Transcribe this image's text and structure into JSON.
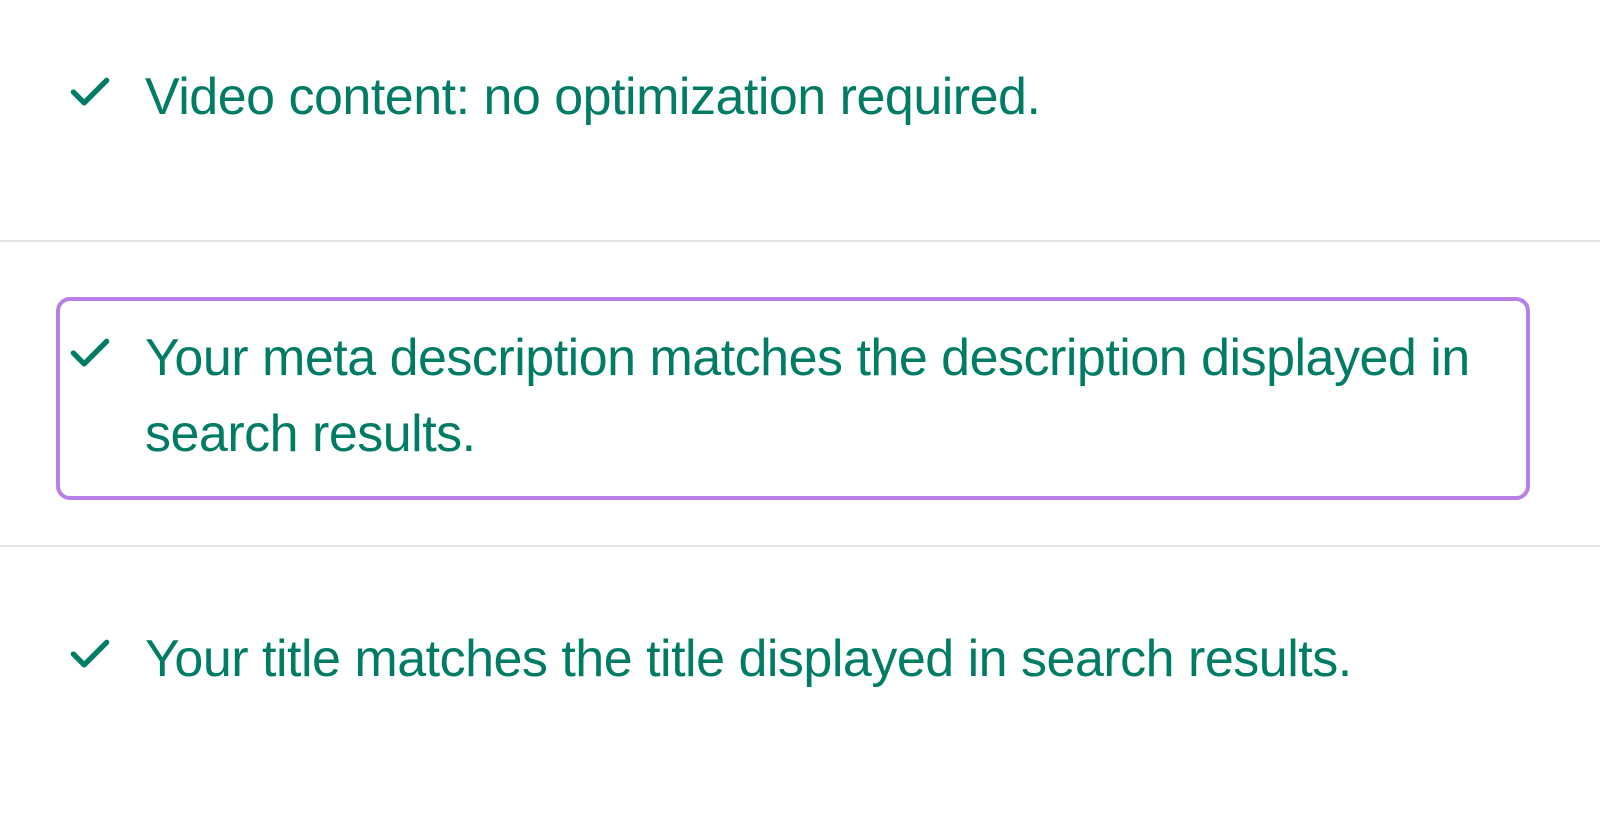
{
  "colors": {
    "text": "#007c65",
    "check": "#007c65",
    "highlight_border": "#b87fe8",
    "divider": "#e4e4e4"
  },
  "items": [
    {
      "text": "Video content: no optimization required.",
      "highlighted": false
    },
    {
      "text": "Your meta description matches the description displayed in search results.",
      "highlighted": true
    },
    {
      "text": "Your title matches the title displayed in search results.",
      "highlighted": false
    }
  ]
}
